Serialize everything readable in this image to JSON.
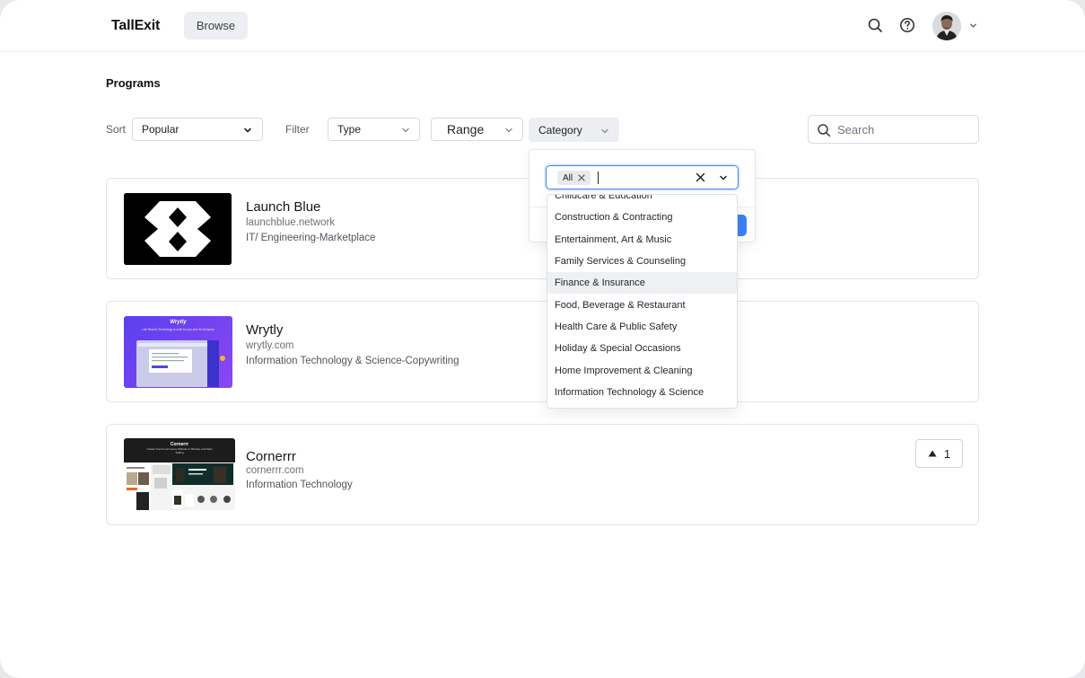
{
  "header": {
    "brand": "TallExit",
    "nav_browse": "Browse"
  },
  "page": {
    "title": "Programs"
  },
  "toolbar": {
    "sort_label": "Sort",
    "sort_value": "Popular",
    "filter_label": "Filter",
    "type_value": "Type",
    "range_value": "Range",
    "category_value": "Category",
    "search_placeholder": "Search"
  },
  "category_dropdown": {
    "selected_tag": "All",
    "items": [
      "Childcare & Education",
      "Construction & Contracting",
      "Entertainment, Art & Music",
      "Family Services & Counseling",
      "Finance & Insurance",
      "Food, Beverage & Restaurant",
      "Health Care & Public Safety",
      "Holiday & Special Occasions",
      "Home Improvement & Cleaning",
      "Information Technology & Science"
    ],
    "hovered_item": "Finance & Insurance"
  },
  "programs": [
    {
      "name": "Launch Blue",
      "url": "launchblue.network",
      "category": "IT/ Engineering-Marketplace"
    },
    {
      "name": "Wrytly",
      "url": "wrytly.com",
      "category": "Information Technology & Science-Copywriting"
    },
    {
      "name": "Cornerrr",
      "url": "cornerrr.com",
      "category": "Information Technology",
      "upvotes": "1"
    }
  ],
  "thumbnails": {
    "wrytly_logo": "Wrytly",
    "wrytly_headline": "Use Real AI Technology to write for you and for everyone",
    "cornerrr_logo": "Cornerrr",
    "cornerrr_headline": "Create Your E-commerce Website in Minutes and Start Selling"
  },
  "colors": {
    "accent": "#3b82f6",
    "hover_row": "#eef0f3",
    "nav_active_bg": "#eceef2"
  }
}
